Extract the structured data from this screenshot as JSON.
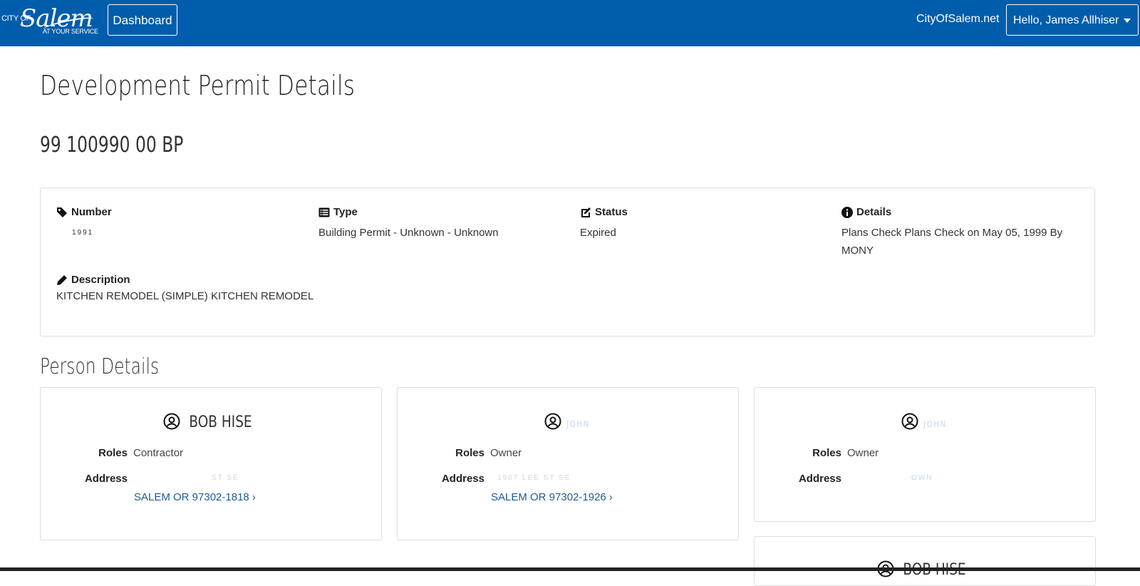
{
  "header": {
    "logo_city": "CITY OF",
    "logo_name": "Salem",
    "logo_tagline": "AT YOUR SERVICE",
    "dashboard_label": "Dashboard",
    "site_link": "CityOfSalem.net",
    "user_greeting": "Hello, James Allhiser"
  },
  "page": {
    "title": "Development Permit Details",
    "permit_id": "99 100990 00 BP"
  },
  "permit": {
    "number_label": "Number",
    "number_value": "1991",
    "type_label": "Type",
    "type_value": "Building Permit - Unknown - Unknown",
    "status_label": "Status",
    "status_value": "Expired",
    "details_label": "Details",
    "details_value": "Plans Check Plans Check on May 05, 1999 By MONY",
    "description_label": "Description",
    "description_value": "KITCHEN REMODEL (SIMPLE) KITCHEN REMODEL"
  },
  "persons_section": {
    "title": "Person Details",
    "roles_label": "Roles",
    "address_label": "Address",
    "people": [
      {
        "name": "BOB HISE",
        "role": "Contractor",
        "address_line1": "ST SE",
        "address_line2": "SALEM OR 97302-1818 ›"
      },
      {
        "name": "JOHN",
        "role": "Owner",
        "address_line1": "1907 LEE ST SE",
        "address_line2": "SALEM OR 97302-1926 ›"
      },
      {
        "name": "JOHN",
        "role": "Owner",
        "address_line1": "OWN",
        "address_line2": ""
      },
      {
        "name": "BOB HISE",
        "role": "",
        "address_line1": "",
        "address_line2": ""
      }
    ]
  },
  "colors": {
    "navbar": "#005dab",
    "link": "#1e5a93"
  }
}
